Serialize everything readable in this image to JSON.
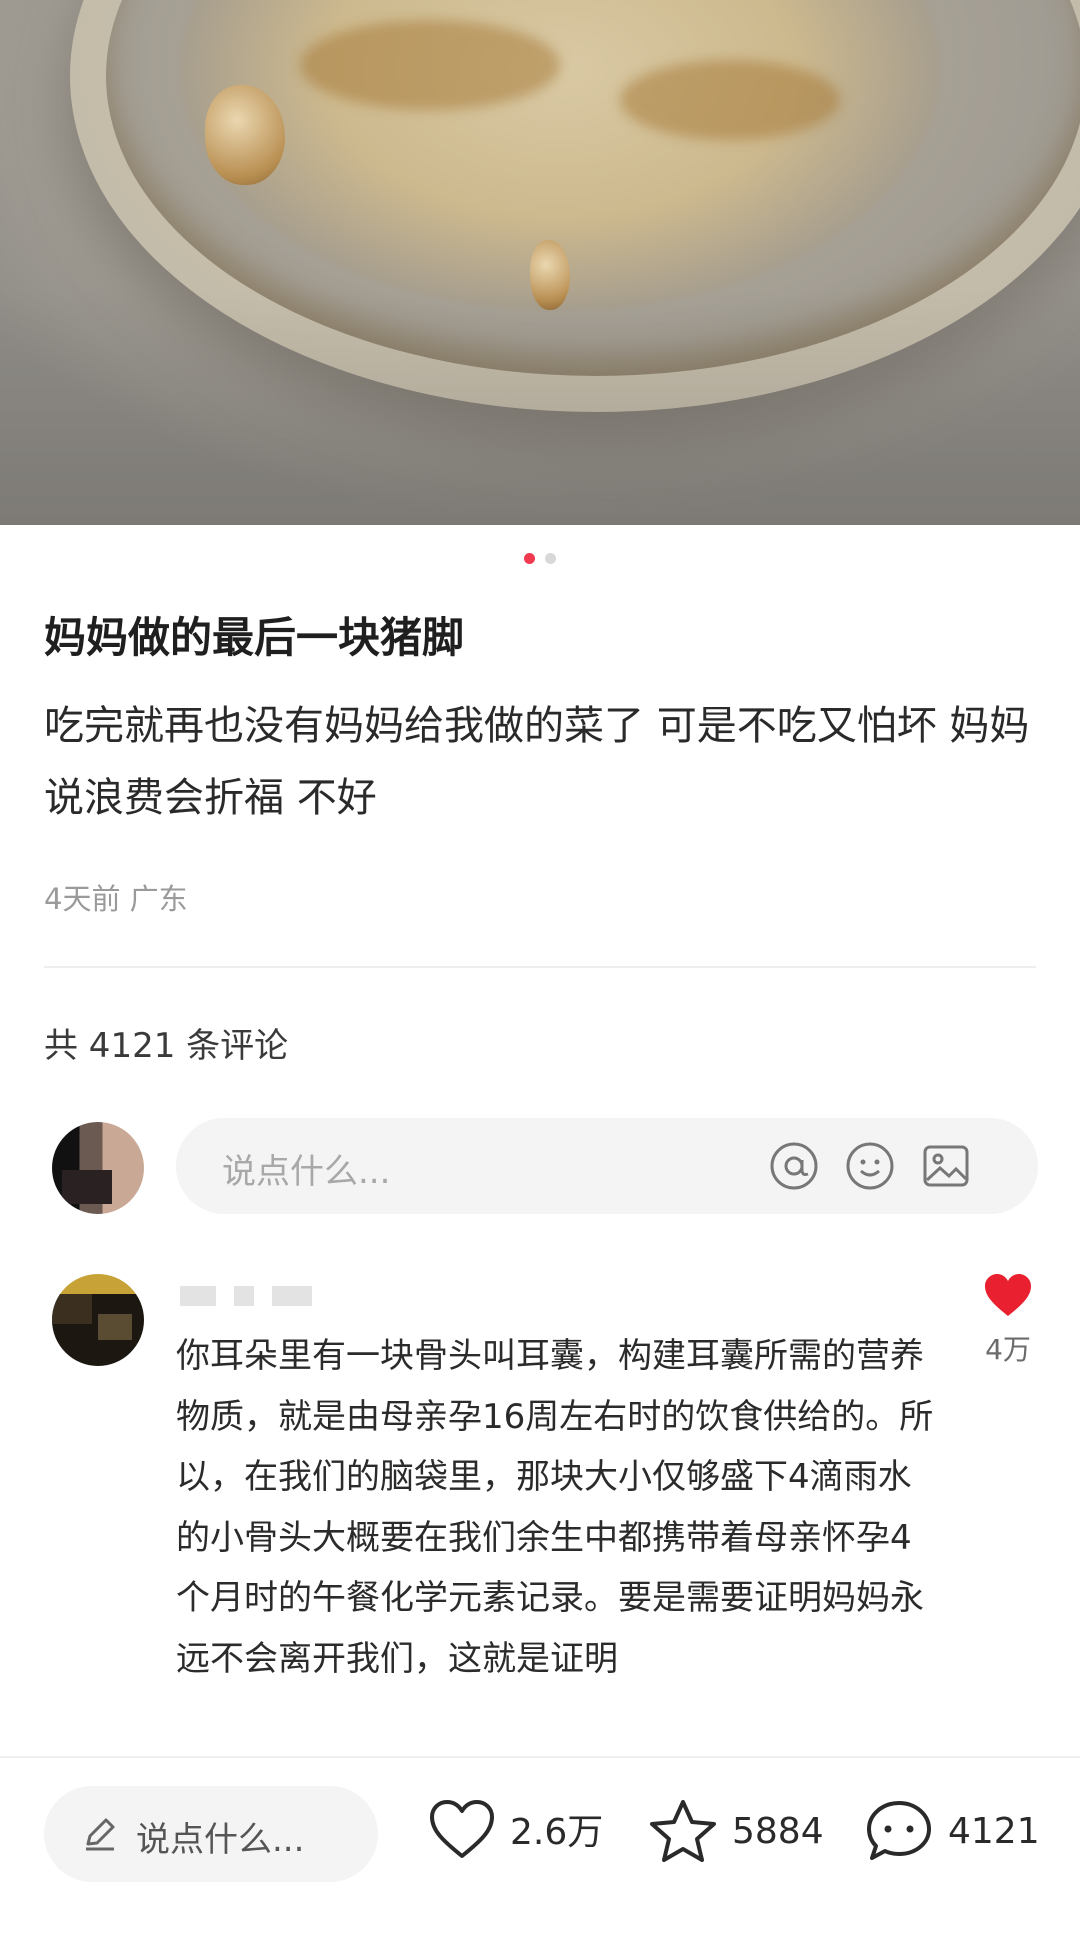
{
  "post": {
    "page_indicator": {
      "count": 2,
      "active": 0
    },
    "title": "妈妈做的最后一块猪脚",
    "body": "吃完就再也没有妈妈给我做的菜了 可是不吃又怕坏 妈妈说浪费会折福 不好",
    "time": "4天前",
    "location": "广东",
    "comment_count_text": "共 4121 条评论"
  },
  "comment_input": {
    "placeholder": "说点什么..."
  },
  "comments": [
    {
      "text": "你耳朵里有一块骨头叫耳囊，构建耳囊所需的营养物质，就是由母亲孕16周左右时的饮食供给的。所以，在我们的脑袋里，那块大小仅够盛下4滴雨水的小骨头大概要在我们余生中都携带着母亲怀孕4个月时的午餐化学元素记录。要是需要证明妈妈永远不会离开我们，这就是证明",
      "like_count": "4万",
      "liked": true
    }
  ],
  "bottom_bar": {
    "input_placeholder": "说点什么...",
    "likes": "2.6万",
    "favorites": "5884",
    "comments": "4121"
  },
  "colors": {
    "accent": "#ef3a4f",
    "like_red": "#e8202f"
  }
}
